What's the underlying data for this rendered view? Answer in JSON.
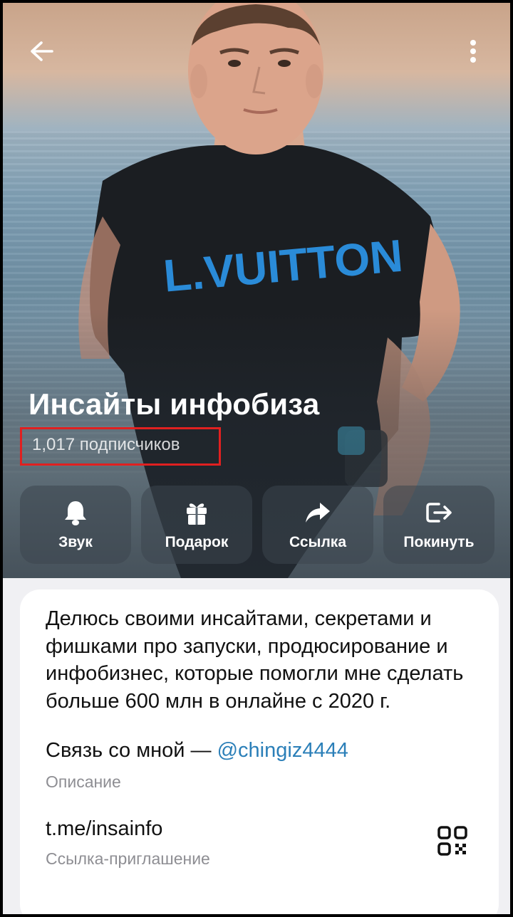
{
  "header": {
    "title": "Инсайты инфобиза",
    "subscribers": "1,017 подписчиков"
  },
  "actions": [
    {
      "label": "Звук",
      "icon": "bell-icon"
    },
    {
      "label": "Подарок",
      "icon": "gift-icon"
    },
    {
      "label": "Ссылка",
      "icon": "share-icon"
    },
    {
      "label": "Покинуть",
      "icon": "leave-icon"
    }
  ],
  "photo": {
    "shirt_text": "L.VUITTON"
  },
  "info": {
    "description": "Делюсь своими инсайтами, секретами и фишками про запуски, продюсирование и инфобизнес, которые помогли мне сделать больше 600 млн в онлайне с 2020 г.",
    "contact_prefix": "Связь со мной — ",
    "contact_mention": "@chingiz4444",
    "description_caption": "Описание",
    "invite_link": "t.me/insainfo",
    "invite_caption": "Ссылка-приглашение"
  },
  "colors": {
    "highlight_border": "#e02020",
    "link": "#2b7fb8",
    "caption": "#8e8e93"
  }
}
